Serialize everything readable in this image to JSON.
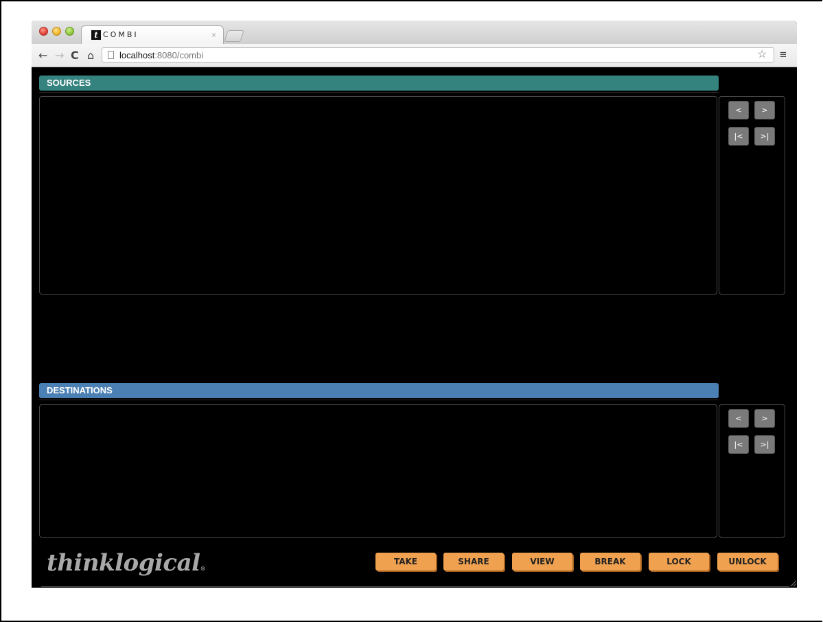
{
  "browser": {
    "tab_title": "COMBI",
    "tab_favicon_letter": "t",
    "tab_close": "×",
    "url_host": "localhost",
    "url_rest": ":8080/combi",
    "icons": {
      "back": "←",
      "forward": "→",
      "reload": "C",
      "home": "⌂",
      "bookmark_star": "☆",
      "menu": "≡"
    }
  },
  "sources": {
    "header": "SOURCES",
    "pager": {
      "prev": "<",
      "next": ">",
      "first": "|<",
      "last": ">|"
    }
  },
  "destinations": {
    "header": "DESTINATIONS",
    "pager": {
      "prev": "<",
      "next": ">",
      "first": "|<",
      "last": ">|"
    }
  },
  "footer": {
    "brand": "thinklogical",
    "brand_mark": "®",
    "actions": [
      "TAKE",
      "SHARE",
      "VIEW",
      "BREAK",
      "LOCK",
      "UNLOCK"
    ]
  },
  "colors": {
    "sources_header": "#35837f",
    "destinations_header": "#4b80b4",
    "action_button": "#f0a14f",
    "pager_button": "#7a7a7a",
    "background": "#000000"
  }
}
